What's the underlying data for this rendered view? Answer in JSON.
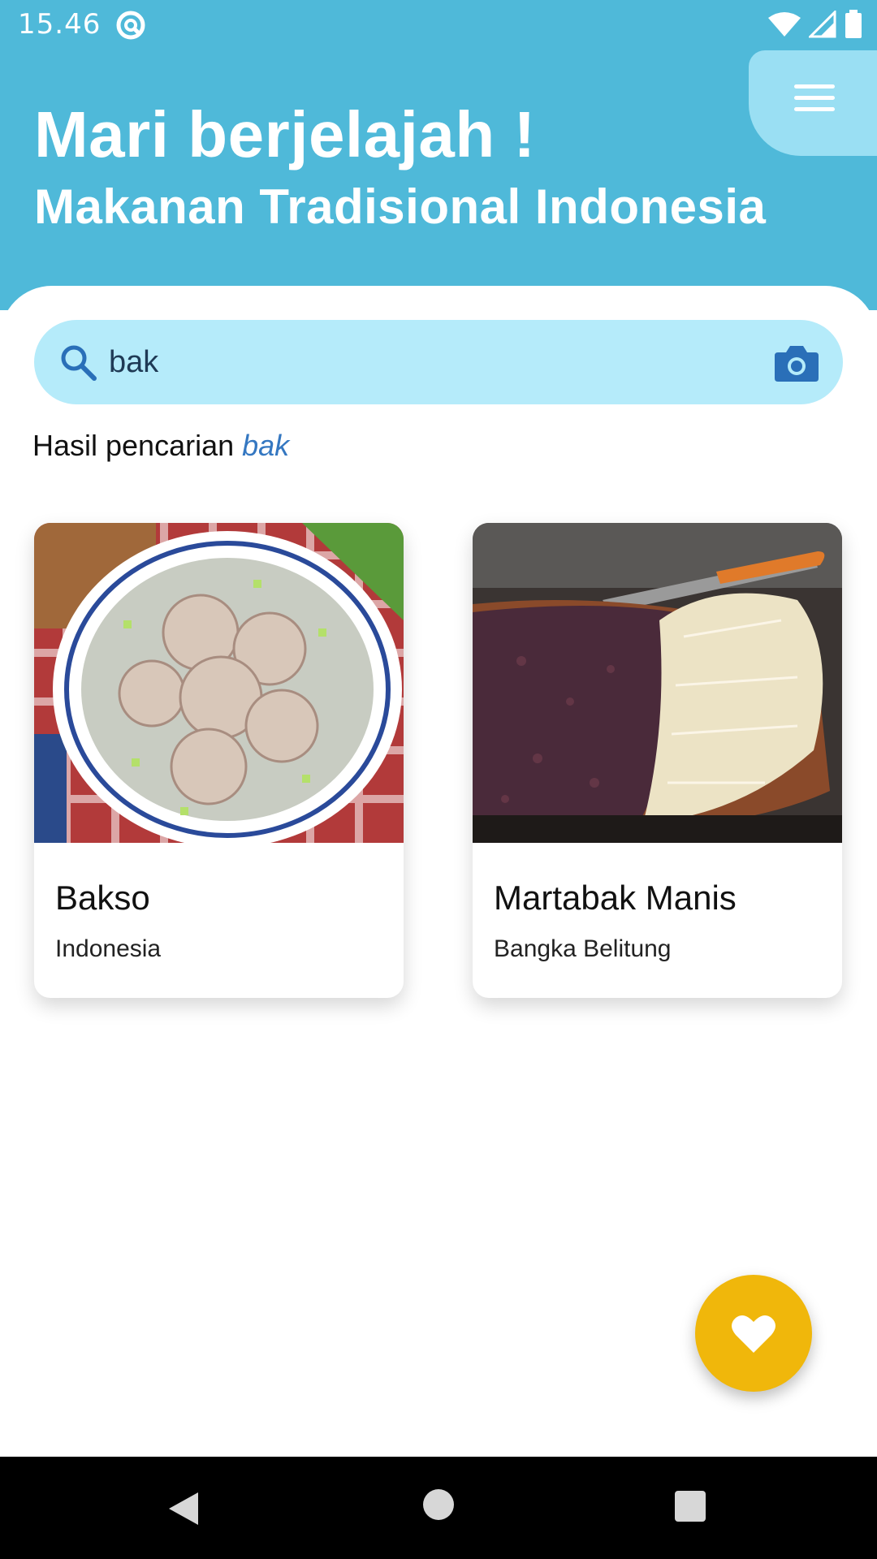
{
  "status_bar": {
    "time": "15.46",
    "icons": [
      "app-notification-icon",
      "wifi-icon",
      "cellular-signal-icon",
      "battery-icon"
    ]
  },
  "header": {
    "title": "Mari berjelajah !",
    "subtitle": "Makanan Tradisional Indonesia",
    "menu_icon": "hamburger-menu-icon",
    "background_color": "#4fb9d9",
    "menu_tab_color": "#9adff3"
  },
  "search": {
    "value": "bak",
    "placeholder": "",
    "left_icon": "search-icon",
    "right_icon": "camera-icon",
    "background_color": "#b5ebfa"
  },
  "results": {
    "label": "Hasil pencarian",
    "query": "bak"
  },
  "cards": [
    {
      "name": "Bakso",
      "origin": "Indonesia",
      "image": "meatball-soup-photo"
    },
    {
      "name": "Martabak Manis",
      "origin": "Bangka Belitung",
      "image": "sweet-martabak-photo"
    }
  ],
  "fab": {
    "icon": "heart-icon",
    "color": "#f0b70b"
  },
  "nav_bar": {
    "icons": [
      "back-triangle-icon",
      "home-circle-icon",
      "recents-square-icon"
    ]
  }
}
